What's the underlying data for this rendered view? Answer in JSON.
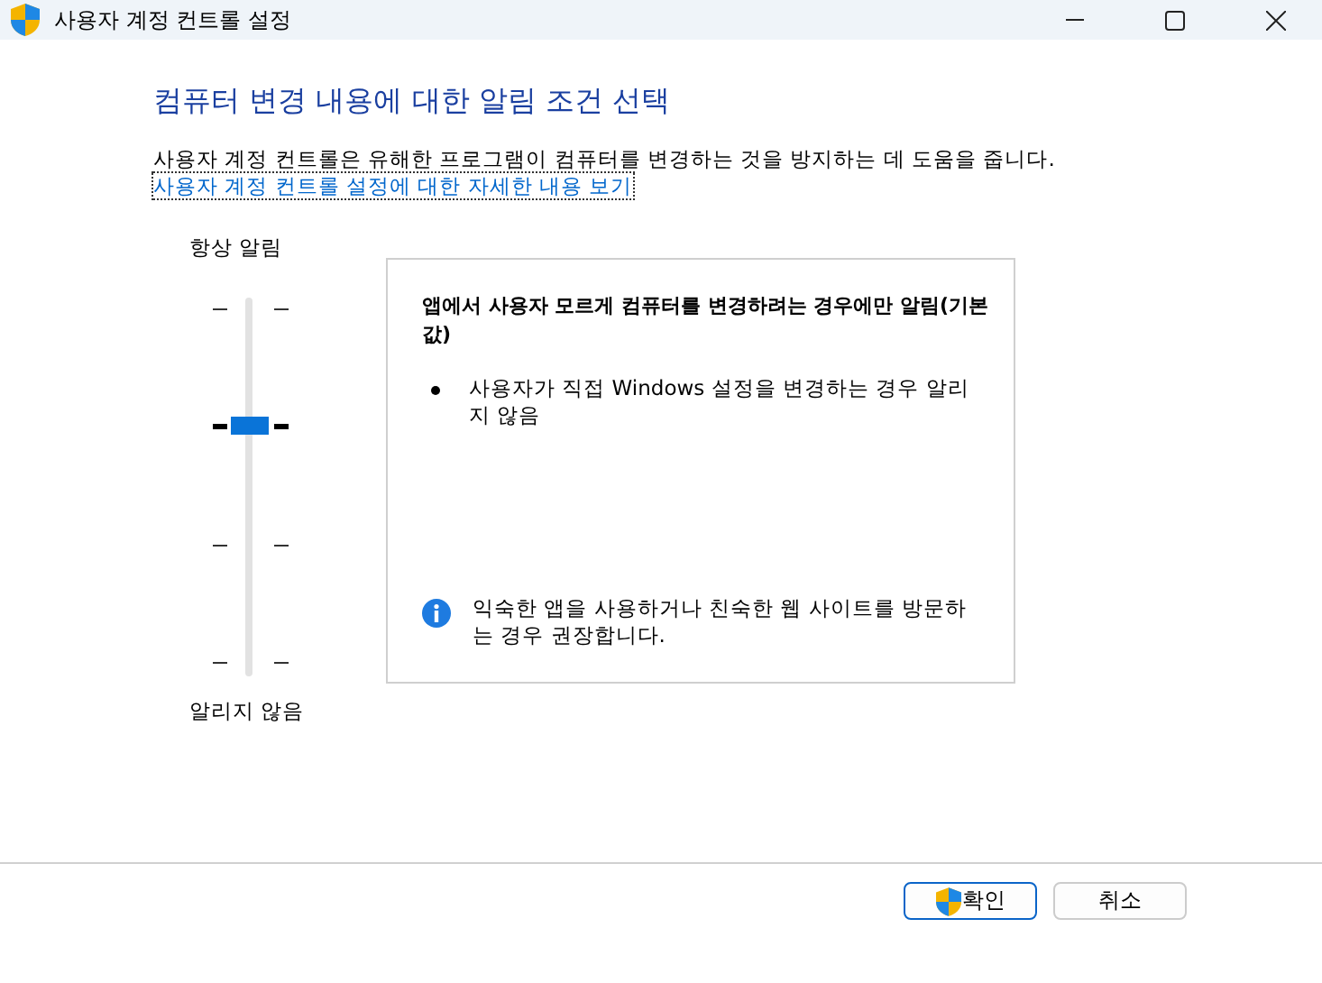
{
  "window": {
    "title": "사용자 계정 컨트롤 설정"
  },
  "heading": "컴퓨터 변경 내용에 대한 알림 조건 선택",
  "description": "사용자 계정 컨트롤은 유해한 프로그램이 컴퓨터를 변경하는 것을 방지하는 데 도움을 줍니다.",
  "link": "사용자 계정 컨트롤 설정에 대한 자세한 내용 보기",
  "slider": {
    "top_label": "항상 알림",
    "bottom_label": "알리지 않음",
    "level": 0.67
  },
  "info_panel": {
    "title": "앱에서 사용자 모르게 컴퓨터를 변경하려는 경우에만 알림(기본값)",
    "bullets": [
      "사용자가 직접 Windows 설정을 변경하는 경우 알리지 않음"
    ],
    "note": "익숙한 앱을 사용하거나 친숙한 웹 사이트를 방문하는 경우 권장합니다."
  },
  "buttons": [
    {
      "label": "확인",
      "kind": "default"
    },
    {
      "label": "취소",
      "kind": "normal"
    }
  ]
}
